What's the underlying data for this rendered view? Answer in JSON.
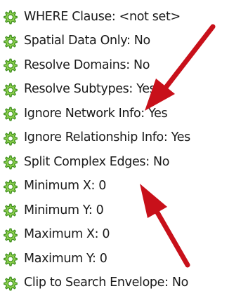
{
  "parameters": [
    {
      "label": "WHERE Clause: <not set>",
      "icon": "gear-icon"
    },
    {
      "label": "Spatial Data Only: No",
      "icon": "gear-icon"
    },
    {
      "label": "Resolve Domains: No",
      "icon": "gear-icon"
    },
    {
      "label": "Resolve Subtypes: Yes",
      "icon": "gear-icon"
    },
    {
      "label": "Ignore Network Info: Yes",
      "icon": "gear-icon"
    },
    {
      "label": "Ignore Relationship Info: Yes",
      "icon": "gear-icon"
    },
    {
      "label": "Split Complex Edges: No",
      "icon": "gear-icon"
    },
    {
      "label": "Minimum X: 0",
      "icon": "gear-icon"
    },
    {
      "label": "Minimum Y: 0",
      "icon": "gear-icon"
    },
    {
      "label": "Maximum X: 0",
      "icon": "gear-icon"
    },
    {
      "label": "Maximum Y: 0",
      "icon": "gear-icon"
    },
    {
      "label": "Clip to Search Envelope: No",
      "icon": "gear-icon"
    }
  ],
  "colors": {
    "gear_fill": "#8fd14f",
    "gear_stroke": "#3f8f1e",
    "arrow": "#c8101a",
    "text": "#1a1a1a"
  }
}
